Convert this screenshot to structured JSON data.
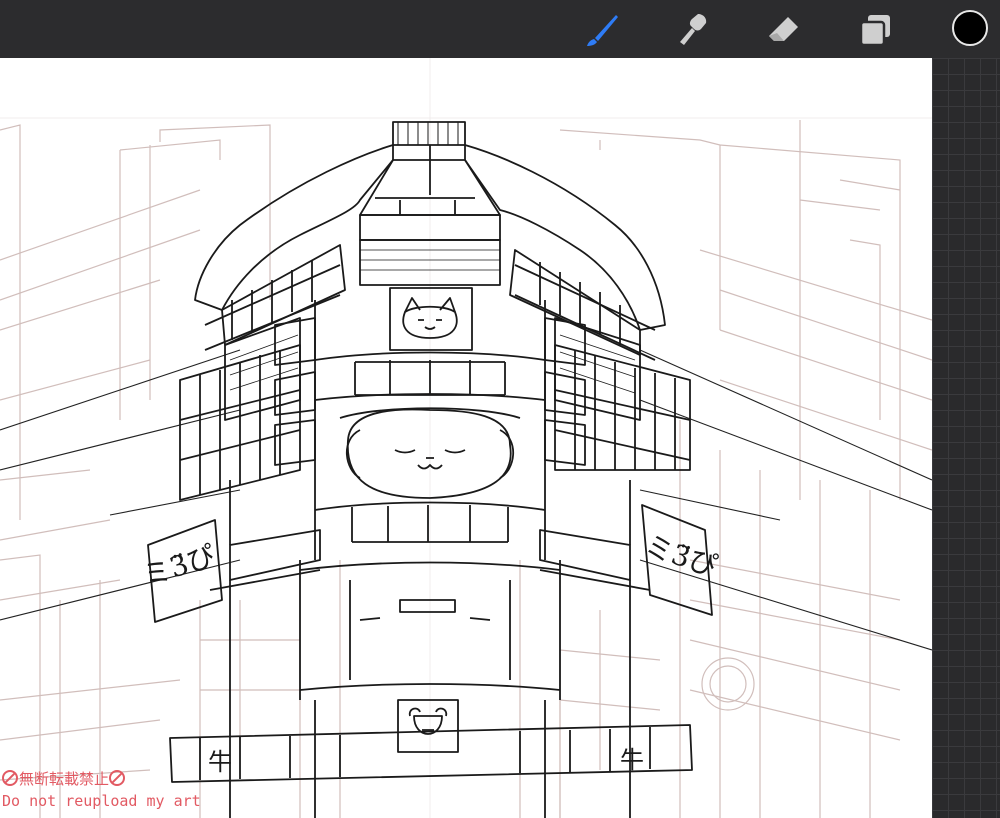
{
  "toolbar": {
    "tools": [
      {
        "name": "brush",
        "icon": "brush-icon",
        "active": true
      },
      {
        "name": "smudge",
        "icon": "smudge-icon",
        "active": false
      },
      {
        "name": "eraser",
        "icon": "eraser-icon",
        "active": false
      },
      {
        "name": "layers",
        "icon": "layers-icon",
        "active": false
      }
    ],
    "current_color": "#000000",
    "active_color": "#2e7cf6"
  },
  "canvas": {
    "signs": {
      "left_sign": "ミ3̈ぴ",
      "right_sign": "ミ3̈ぴ",
      "left_banner_kanji": "牛",
      "right_banner_kanji": "牛"
    },
    "watermark": {
      "line1": "無断転載禁止",
      "line2": "Do not reupload my art"
    }
  }
}
